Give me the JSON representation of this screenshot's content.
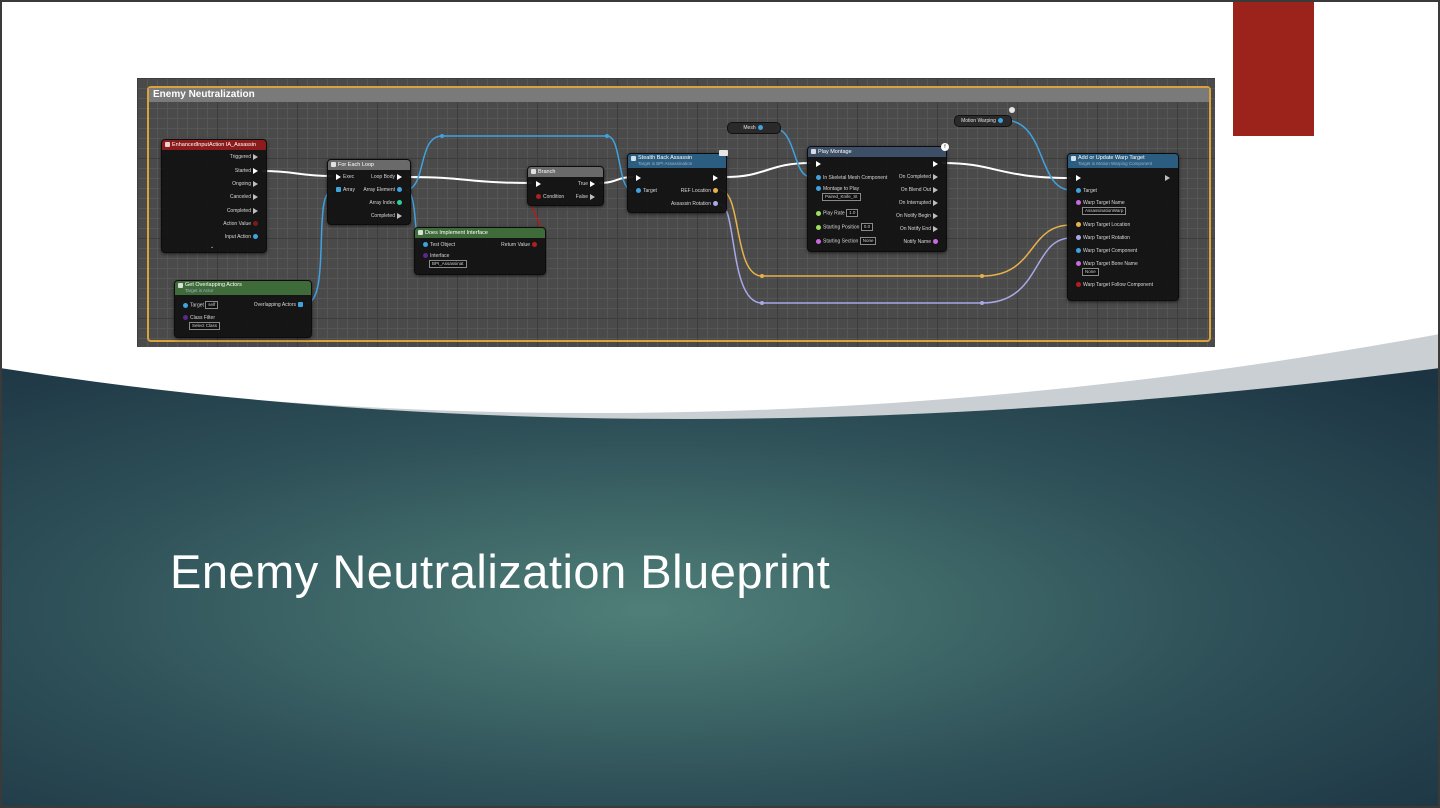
{
  "slide": {
    "title": "Enemy Neutralization Blueprint",
    "colors": {
      "accent": "#9b231c",
      "dark_teal": "#1f3a48",
      "glow_teal": "#4f7f78",
      "wave_light": "#c9cfd2"
    }
  },
  "blueprint": {
    "comment_title": "Enemy Neutralization",
    "colors": {
      "comment_border": "#d9a23a",
      "exec_wire": "#ffffff",
      "object_wire": "#3fa3e0",
      "vector_wire": "#e8b24a",
      "rotator_wire": "#a8a8e8"
    },
    "nodes": {
      "input_action": {
        "title": "EnhancedInputAction IA_Assassin",
        "icon": "input-action-icon",
        "pins": [
          "Triggered",
          "Started",
          "Ongoing",
          "Canceled",
          "Completed",
          "Action Value",
          "Input Action"
        ],
        "expand": "⌄"
      },
      "overlapping": {
        "title": "Get Overlapping Actors",
        "subtitle": "Target is Actor",
        "target_label": "Target",
        "target_value": "self",
        "out_label": "Overlapping Actors",
        "class_filter_label": "Class Filter",
        "class_filter_value": "Select Class"
      },
      "for_each": {
        "title": "For Each Loop",
        "inputs": [
          "Exec",
          "Array"
        ],
        "outputs": [
          "Loop Body",
          "Array Element",
          "Array Index",
          "Completed"
        ]
      },
      "does_implement": {
        "title": "Does Implement Interface",
        "test_object": "Test Object",
        "return_value": "Return Value",
        "interface_label": "Interface",
        "interface_value": "BPI_Assassinat"
      },
      "branch": {
        "title": "Branch",
        "condition": "Condition",
        "true_label": "True",
        "false_label": "False"
      },
      "stealth": {
        "title": "Stealth Back Assassin",
        "subtitle": "Target is BPI Assassination",
        "target": "Target",
        "outputs": [
          "REF Location",
          "Assassin Rotation"
        ]
      },
      "mesh_chip": {
        "label": "Mesh"
      },
      "play_montage": {
        "title": "Play Montage",
        "badge": "f",
        "inputs": [
          "In Skeletal Mesh Component",
          "Montage to Play",
          "Play Rate",
          "Starting Position",
          "Starting Section"
        ],
        "montage_value": "Paired_Knife_St",
        "play_rate_value": "1.0",
        "start_pos_value": "0.0",
        "start_section_value": "None",
        "outputs": [
          "On Completed",
          "On Blend Out",
          "On Interrupted",
          "On Notify Begin",
          "On Notify End",
          "Notify Name"
        ]
      },
      "motion_chip": {
        "label": "Motion Warping"
      },
      "add_warp": {
        "title": "Add or Update Warp Target",
        "subtitle": "Target is Motion Warping Component",
        "inputs": [
          "Target",
          "Warp Target Name",
          "Warp Target Location",
          "Warp Target Rotation",
          "Warp Target Component",
          "Warp Target Bone Name",
          "Warp Target Follow Component"
        ],
        "warp_name_value": "AssassinationWarp",
        "bone_value": "None"
      }
    }
  }
}
